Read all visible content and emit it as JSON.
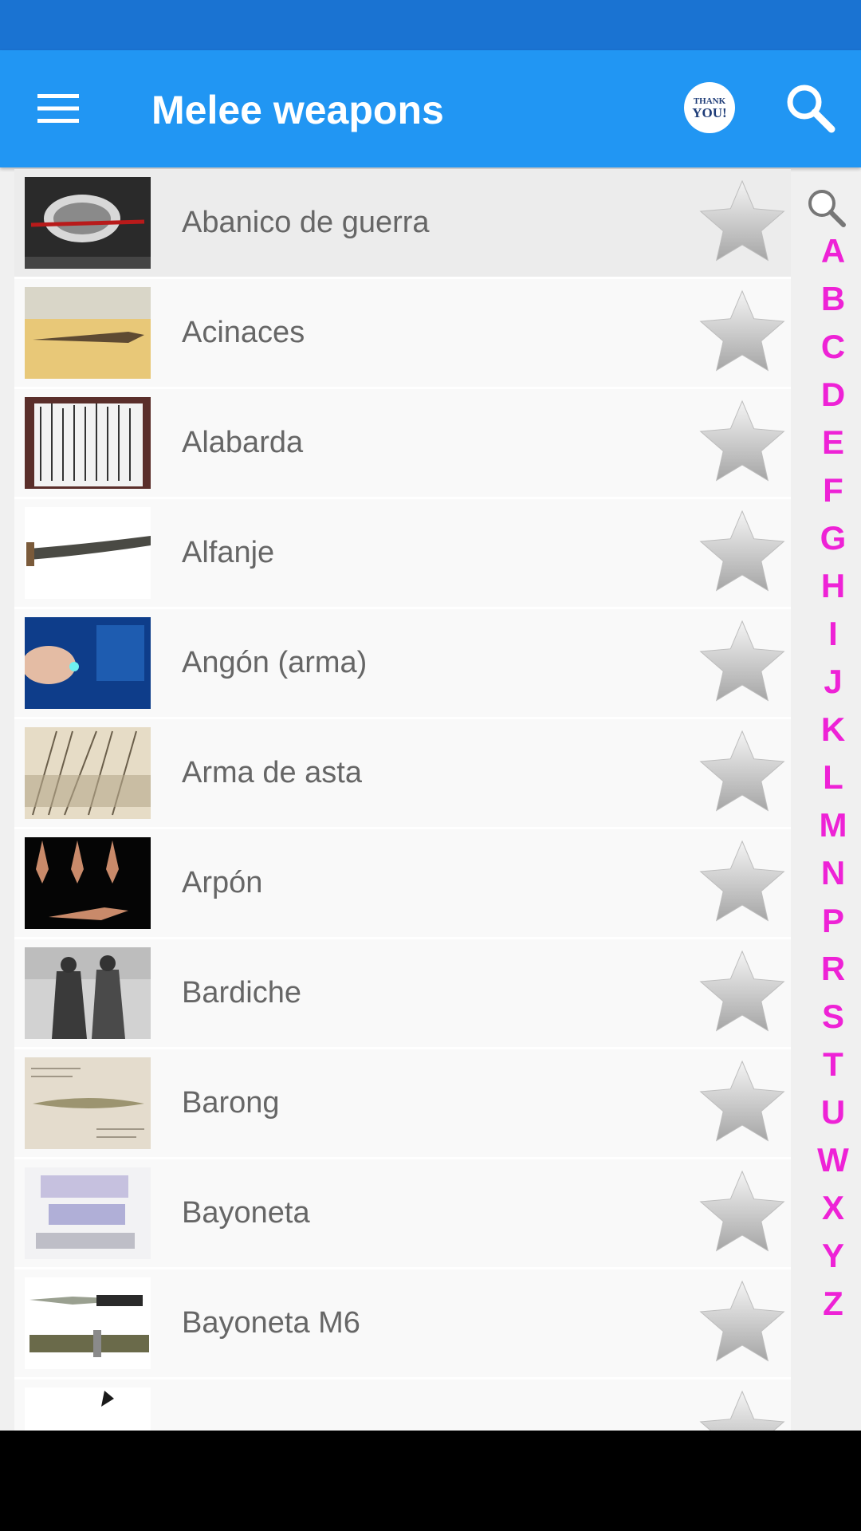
{
  "app": {
    "title": "Melee weapons",
    "thanks_badge_top": "THANK",
    "thanks_badge_bottom": "YOU!"
  },
  "colors": {
    "status_bar": "#1a73d2",
    "app_bar": "#2196f3",
    "index_letter": "#ee22d6",
    "item_text": "#666666"
  },
  "icons": {
    "menu": "hamburger-menu-icon",
    "search": "search-icon",
    "thanks": "thank-you-badge-icon",
    "favorite": "star-icon",
    "index_search": "magnifier-icon"
  },
  "items": [
    {
      "label": "Abanico de guerra",
      "selected": true
    },
    {
      "label": "Acinaces"
    },
    {
      "label": "Alabarda"
    },
    {
      "label": "Alfanje"
    },
    {
      "label": "Angón (arma)"
    },
    {
      "label": "Arma de asta"
    },
    {
      "label": "Arpón"
    },
    {
      "label": "Bardiche"
    },
    {
      "label": "Barong"
    },
    {
      "label": "Bayoneta"
    },
    {
      "label": "Bayoneta M6"
    }
  ],
  "index": [
    "A",
    "B",
    "C",
    "D",
    "E",
    "F",
    "G",
    "H",
    "I",
    "J",
    "K",
    "L",
    "M",
    "N",
    "P",
    "R",
    "S",
    "T",
    "U",
    "W",
    "X",
    "Y",
    "Z"
  ]
}
